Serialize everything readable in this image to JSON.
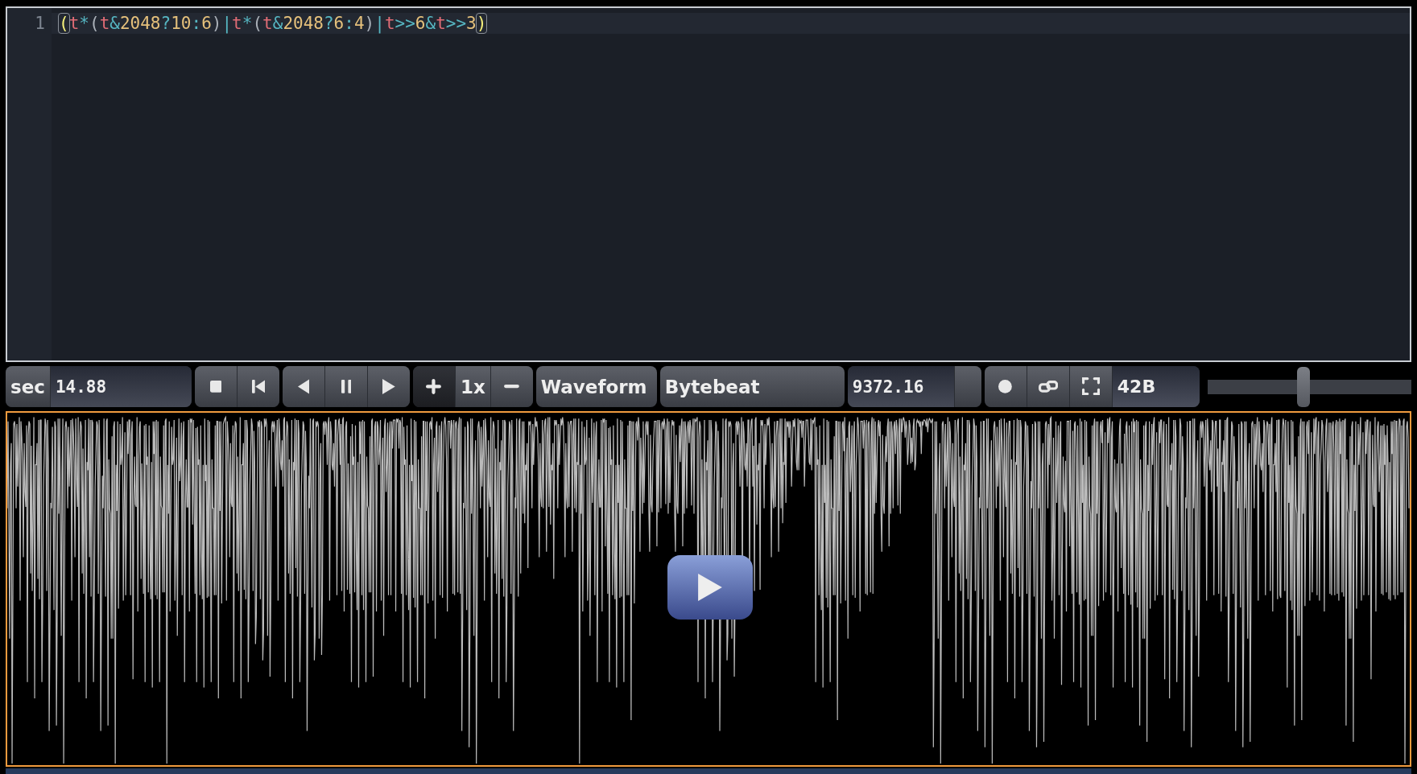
{
  "editor": {
    "lines": [
      {
        "number": "1",
        "tokens": [
          {
            "text": "(",
            "kind": "paren",
            "matched": true
          },
          {
            "text": "t",
            "kind": "var"
          },
          {
            "text": "*",
            "kind": "op"
          },
          {
            "text": "(",
            "kind": "paren",
            "matched": false
          },
          {
            "text": "t",
            "kind": "var"
          },
          {
            "text": "&",
            "kind": "op"
          },
          {
            "text": "2048",
            "kind": "num"
          },
          {
            "text": "?",
            "kind": "op"
          },
          {
            "text": "10",
            "kind": "num"
          },
          {
            "text": ":",
            "kind": "op"
          },
          {
            "text": "6",
            "kind": "num"
          },
          {
            "text": ")",
            "kind": "paren",
            "matched": false
          },
          {
            "text": "|",
            "kind": "op"
          },
          {
            "text": "t",
            "kind": "var"
          },
          {
            "text": "*",
            "kind": "op"
          },
          {
            "text": "(",
            "kind": "paren",
            "matched": false
          },
          {
            "text": "t",
            "kind": "var"
          },
          {
            "text": "&",
            "kind": "op"
          },
          {
            "text": "2048",
            "kind": "num"
          },
          {
            "text": "?",
            "kind": "op"
          },
          {
            "text": "6",
            "kind": "num"
          },
          {
            "text": ":",
            "kind": "op"
          },
          {
            "text": "4",
            "kind": "num"
          },
          {
            "text": ")",
            "kind": "paren",
            "matched": false
          },
          {
            "text": "|",
            "kind": "op"
          },
          {
            "text": "t",
            "kind": "var"
          },
          {
            "text": ">>",
            "kind": "op"
          },
          {
            "text": "6",
            "kind": "num"
          },
          {
            "text": "&",
            "kind": "op"
          },
          {
            "text": "t",
            "kind": "var"
          },
          {
            "text": ">>",
            "kind": "op"
          },
          {
            "text": "3",
            "kind": "num"
          },
          {
            "text": ")",
            "kind": "paren",
            "matched": true
          }
        ]
      }
    ]
  },
  "controls": {
    "time_unit": "sec",
    "time_value": "14.88",
    "speed": "1x",
    "draw_mode": "Waveform",
    "mode": "Bytebeat",
    "sample_rate": "9372.16",
    "size": "42B",
    "volume": {
      "level": 0.47
    }
  }
}
